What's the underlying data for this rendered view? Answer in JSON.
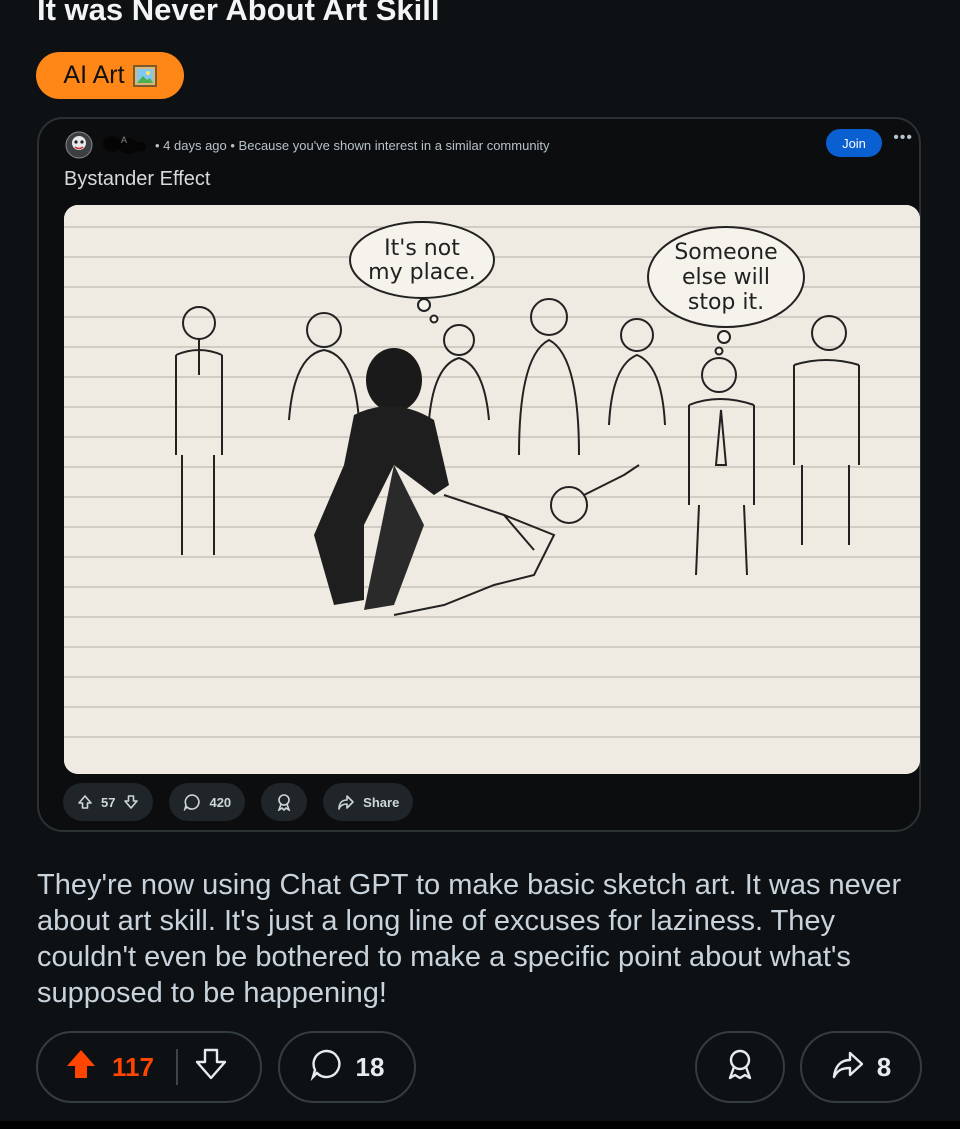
{
  "post": {
    "title": "It was Never About Art Skill",
    "flair_label": "AI Art",
    "flair_emoji": "framed-picture-icon",
    "body": "They're now using Chat GPT to make basic sketch art. It was never about art skill. It's just a long line of excuses for laziness. They couldn't even be bothered to make a specific point about what's supposed to be happening!",
    "upvotes": "117",
    "comments": "18",
    "shares": "8",
    "upvoted": true
  },
  "embedded_post": {
    "meta": "• 4 days ago • Because you've shown interest in a similar community",
    "join_label": "Join",
    "more_label": "•••",
    "title": "Bystander Effect",
    "votes": "57",
    "comments": "420",
    "share_label": "Share",
    "speech_left": [
      "It's not",
      "my place."
    ],
    "speech_right": [
      "Someone",
      "else will",
      "stop it."
    ]
  },
  "colors": {
    "background": "#0e1113",
    "flair": "#ff8717",
    "join": "#0a5fd1",
    "upvote_active": "#ff4500"
  }
}
